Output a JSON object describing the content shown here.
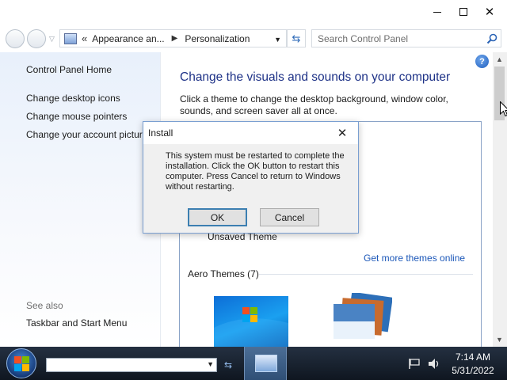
{
  "window": {
    "minimize_glyph": "–",
    "maximize_glyph": "□",
    "close_glyph": "✕"
  },
  "navbar": {
    "back_icon": "back-arrow-icon",
    "forward_icon": "forward-arrow-icon",
    "recent_glyph": "▽",
    "breadcrumb_chevron": "«",
    "breadcrumb": [
      "Appearance an...",
      "Personalization"
    ],
    "breadcrumb_separator": "▶",
    "dropdown_glyph": "▼",
    "refresh_glyph": "⇆",
    "search_placeholder": "Search Control Panel"
  },
  "left_pane": {
    "links": [
      "Control Panel Home",
      "Change desktop icons",
      "Change mouse pointers",
      "Change your account pictur"
    ],
    "see_also_label": "See also",
    "see_also_links": [
      "Taskbar and Start Menu"
    ]
  },
  "main": {
    "heading": "Change the visuals and sounds on your computer",
    "description": "Click a theme to change the desktop background, window color, sounds, and screen saver all at once.",
    "my_themes": {
      "unsaved_theme": "Unsaved Theme",
      "get_more_link": "Get more themes online"
    },
    "aero_themes_label": "Aero Themes (7)",
    "help_glyph": "?"
  },
  "dialog": {
    "title": "Install",
    "close_glyph": "✕",
    "message": "This system must be restarted to complete the installation. Click the OK button to restart this computer. Press Cancel to return to Windows without restarting.",
    "ok_label": "OK",
    "cancel_label": "Cancel"
  },
  "scrollbar": {
    "up_glyph": "▲",
    "down_glyph": "▼"
  },
  "taskbar": {
    "address_dropdown_glyph": "▼",
    "go_glyph": "⇆",
    "time": "7:14 AM",
    "date": "5/31/2022"
  },
  "colors": {
    "heading": "#1e3287",
    "link": "#1a56b8",
    "dialog_bg": "#f0f0f0",
    "taskbar": "#1a2432",
    "ok_border": "#3c7fb1"
  }
}
